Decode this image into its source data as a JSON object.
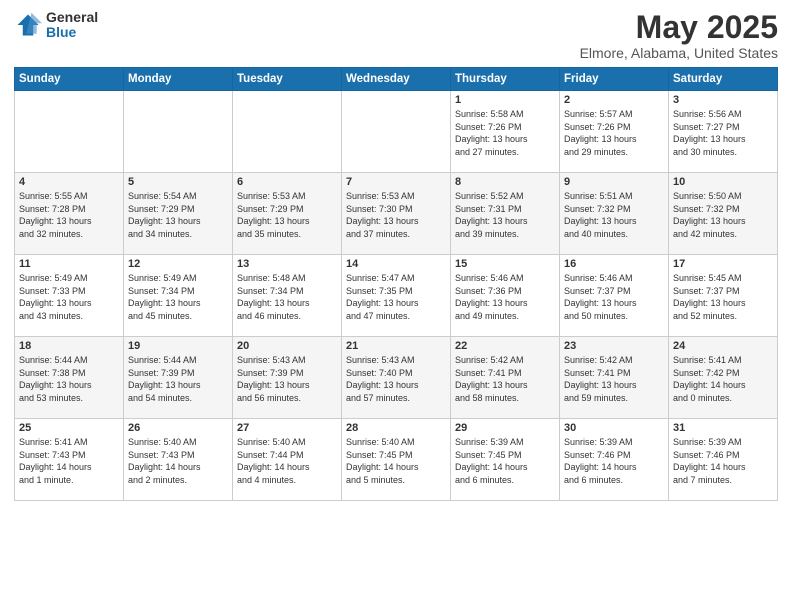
{
  "logo": {
    "general": "General",
    "blue": "Blue"
  },
  "title": "May 2025",
  "subtitle": "Elmore, Alabama, United States",
  "days_of_week": [
    "Sunday",
    "Monday",
    "Tuesday",
    "Wednesday",
    "Thursday",
    "Friday",
    "Saturday"
  ],
  "weeks": [
    [
      {
        "day": "",
        "info": ""
      },
      {
        "day": "",
        "info": ""
      },
      {
        "day": "",
        "info": ""
      },
      {
        "day": "",
        "info": ""
      },
      {
        "day": "1",
        "info": "Sunrise: 5:58 AM\nSunset: 7:26 PM\nDaylight: 13 hours\nand 27 minutes."
      },
      {
        "day": "2",
        "info": "Sunrise: 5:57 AM\nSunset: 7:26 PM\nDaylight: 13 hours\nand 29 minutes."
      },
      {
        "day": "3",
        "info": "Sunrise: 5:56 AM\nSunset: 7:27 PM\nDaylight: 13 hours\nand 30 minutes."
      }
    ],
    [
      {
        "day": "4",
        "info": "Sunrise: 5:55 AM\nSunset: 7:28 PM\nDaylight: 13 hours\nand 32 minutes."
      },
      {
        "day": "5",
        "info": "Sunrise: 5:54 AM\nSunset: 7:29 PM\nDaylight: 13 hours\nand 34 minutes."
      },
      {
        "day": "6",
        "info": "Sunrise: 5:53 AM\nSunset: 7:29 PM\nDaylight: 13 hours\nand 35 minutes."
      },
      {
        "day": "7",
        "info": "Sunrise: 5:53 AM\nSunset: 7:30 PM\nDaylight: 13 hours\nand 37 minutes."
      },
      {
        "day": "8",
        "info": "Sunrise: 5:52 AM\nSunset: 7:31 PM\nDaylight: 13 hours\nand 39 minutes."
      },
      {
        "day": "9",
        "info": "Sunrise: 5:51 AM\nSunset: 7:32 PM\nDaylight: 13 hours\nand 40 minutes."
      },
      {
        "day": "10",
        "info": "Sunrise: 5:50 AM\nSunset: 7:32 PM\nDaylight: 13 hours\nand 42 minutes."
      }
    ],
    [
      {
        "day": "11",
        "info": "Sunrise: 5:49 AM\nSunset: 7:33 PM\nDaylight: 13 hours\nand 43 minutes."
      },
      {
        "day": "12",
        "info": "Sunrise: 5:49 AM\nSunset: 7:34 PM\nDaylight: 13 hours\nand 45 minutes."
      },
      {
        "day": "13",
        "info": "Sunrise: 5:48 AM\nSunset: 7:34 PM\nDaylight: 13 hours\nand 46 minutes."
      },
      {
        "day": "14",
        "info": "Sunrise: 5:47 AM\nSunset: 7:35 PM\nDaylight: 13 hours\nand 47 minutes."
      },
      {
        "day": "15",
        "info": "Sunrise: 5:46 AM\nSunset: 7:36 PM\nDaylight: 13 hours\nand 49 minutes."
      },
      {
        "day": "16",
        "info": "Sunrise: 5:46 AM\nSunset: 7:37 PM\nDaylight: 13 hours\nand 50 minutes."
      },
      {
        "day": "17",
        "info": "Sunrise: 5:45 AM\nSunset: 7:37 PM\nDaylight: 13 hours\nand 52 minutes."
      }
    ],
    [
      {
        "day": "18",
        "info": "Sunrise: 5:44 AM\nSunset: 7:38 PM\nDaylight: 13 hours\nand 53 minutes."
      },
      {
        "day": "19",
        "info": "Sunrise: 5:44 AM\nSunset: 7:39 PM\nDaylight: 13 hours\nand 54 minutes."
      },
      {
        "day": "20",
        "info": "Sunrise: 5:43 AM\nSunset: 7:39 PM\nDaylight: 13 hours\nand 56 minutes."
      },
      {
        "day": "21",
        "info": "Sunrise: 5:43 AM\nSunset: 7:40 PM\nDaylight: 13 hours\nand 57 minutes."
      },
      {
        "day": "22",
        "info": "Sunrise: 5:42 AM\nSunset: 7:41 PM\nDaylight: 13 hours\nand 58 minutes."
      },
      {
        "day": "23",
        "info": "Sunrise: 5:42 AM\nSunset: 7:41 PM\nDaylight: 13 hours\nand 59 minutes."
      },
      {
        "day": "24",
        "info": "Sunrise: 5:41 AM\nSunset: 7:42 PM\nDaylight: 14 hours\nand 0 minutes."
      }
    ],
    [
      {
        "day": "25",
        "info": "Sunrise: 5:41 AM\nSunset: 7:43 PM\nDaylight: 14 hours\nand 1 minute."
      },
      {
        "day": "26",
        "info": "Sunrise: 5:40 AM\nSunset: 7:43 PM\nDaylight: 14 hours\nand 2 minutes."
      },
      {
        "day": "27",
        "info": "Sunrise: 5:40 AM\nSunset: 7:44 PM\nDaylight: 14 hours\nand 4 minutes."
      },
      {
        "day": "28",
        "info": "Sunrise: 5:40 AM\nSunset: 7:45 PM\nDaylight: 14 hours\nand 5 minutes."
      },
      {
        "day": "29",
        "info": "Sunrise: 5:39 AM\nSunset: 7:45 PM\nDaylight: 14 hours\nand 6 minutes."
      },
      {
        "day": "30",
        "info": "Sunrise: 5:39 AM\nSunset: 7:46 PM\nDaylight: 14 hours\nand 6 minutes."
      },
      {
        "day": "31",
        "info": "Sunrise: 5:39 AM\nSunset: 7:46 PM\nDaylight: 14 hours\nand 7 minutes."
      }
    ]
  ]
}
